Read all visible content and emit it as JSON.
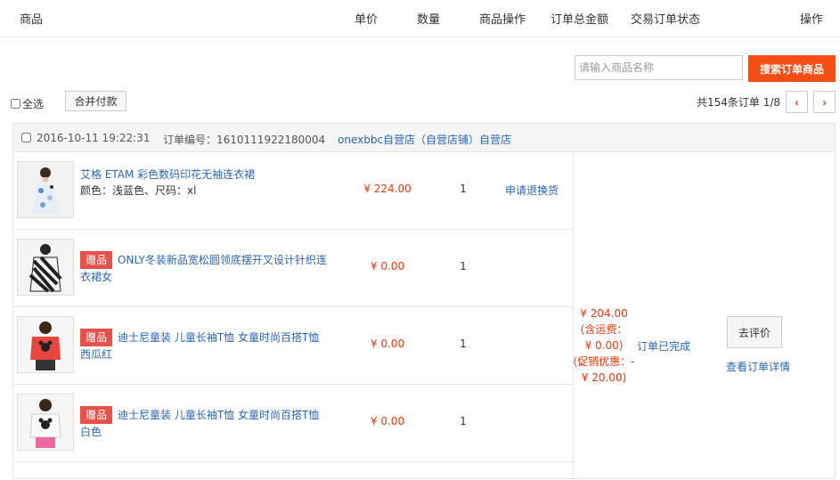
{
  "header": {
    "product": "商品",
    "unit_price": "单价",
    "quantity": "数量",
    "product_ops": "商品操作",
    "order_total": "订单总金额",
    "trade_status": "交易订单状态",
    "ops": "操作"
  },
  "search": {
    "placeholder": "请输入商品名称",
    "button_label": "搜索订单商品"
  },
  "toolbar": {
    "select_all_label": "全选",
    "merge_pay_label": "合并付款",
    "pager_info": "共154条订单 1/8",
    "prev_label": "‹",
    "next_label": "›"
  },
  "order": {
    "time": "2016-10-11 19:22:31",
    "order_no": "订单编号：1610111922180004",
    "shop": "onexbbc自营店（自营店铺）自营店",
    "items": [
      {
        "title": "艾格 ETAM 彩色数码印花无袖连衣裙",
        "attrs": "颜色：浅蓝色、尺码：xl",
        "gift": "",
        "price": "¥ 224.00",
        "qty": "1",
        "op": "申请退换货"
      },
      {
        "title": "ONLY冬装新品宽松圆领底摆开叉设计针织连衣裙女",
        "attrs": "",
        "gift": "赠品",
        "price": "¥ 0.00",
        "qty": "1",
        "op": ""
      },
      {
        "title": "迪士尼童装 儿童长袖T恤 女童时尚百搭T恤西瓜红",
        "attrs": "",
        "gift": "赠品",
        "price": "¥ 0.00",
        "qty": "1",
        "op": ""
      },
      {
        "title": "迪士尼童装 儿童长袖T恤 女童时尚百搭T恤白色",
        "attrs": "",
        "gift": "赠品",
        "price": "¥ 0.00",
        "qty": "1",
        "op": ""
      }
    ],
    "total": "¥ 204.00",
    "shipping": "(含运费：",
    "shipping_value": "¥ 0.00)",
    "promo": "(促销优惠：-",
    "promo_value": "¥ 20.00)",
    "status": "订单已完成",
    "review_label": "去评价",
    "detail_label": "查看订单详情"
  },
  "colors": {
    "accent": "#f54e14",
    "price": "#e8380d",
    "link": "#2a65b5",
    "gift_badge": "#e9504a"
  }
}
